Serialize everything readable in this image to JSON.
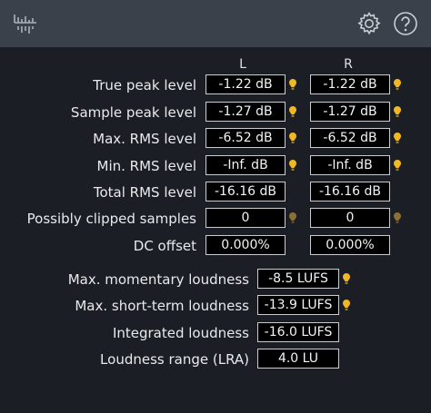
{
  "columns": {
    "left": "L",
    "right": "R"
  },
  "rows": [
    {
      "label": "True peak level",
      "left": "-1.22 dB",
      "right": "-1.22 dB",
      "indicator": "bright"
    },
    {
      "label": "Sample peak level",
      "left": "-1.27 dB",
      "right": "-1.27 dB",
      "indicator": "bright"
    },
    {
      "label": "Max. RMS level",
      "left": "-6.52 dB",
      "right": "-6.52 dB",
      "indicator": "bright"
    },
    {
      "label": "Min. RMS level",
      "left": "-Inf. dB",
      "right": "-Inf. dB",
      "indicator": "bright"
    },
    {
      "label": "Total RMS level",
      "left": "-16.16 dB",
      "right": "-16.16 dB",
      "indicator": "none"
    },
    {
      "label": "Possibly clipped samples",
      "left": "0",
      "right": "0",
      "indicator": "dim"
    },
    {
      "label": "DC offset",
      "left": "0.000%",
      "right": "0.000%",
      "indicator": "none"
    }
  ],
  "loudness": [
    {
      "label": "Max. momentary loudness",
      "value": "-8.5 LUFS",
      "indicator": "bright"
    },
    {
      "label": "Max. short-term loudness",
      "value": "-13.9 LUFS",
      "indicator": "bright"
    },
    {
      "label": "Integrated loudness",
      "value": "-16.0 LUFS",
      "indicator": "none"
    },
    {
      "label": "Loudness range (LRA)",
      "value": "4.0 LU",
      "indicator": "none"
    }
  ],
  "icons": {
    "app": "waveform-meter-icon",
    "settings": "gear-icon",
    "help": "help-icon"
  },
  "colors": {
    "indicator_bright": "#f2b823",
    "indicator_dim": "#8a7033",
    "titlebar": "#3a414b"
  }
}
